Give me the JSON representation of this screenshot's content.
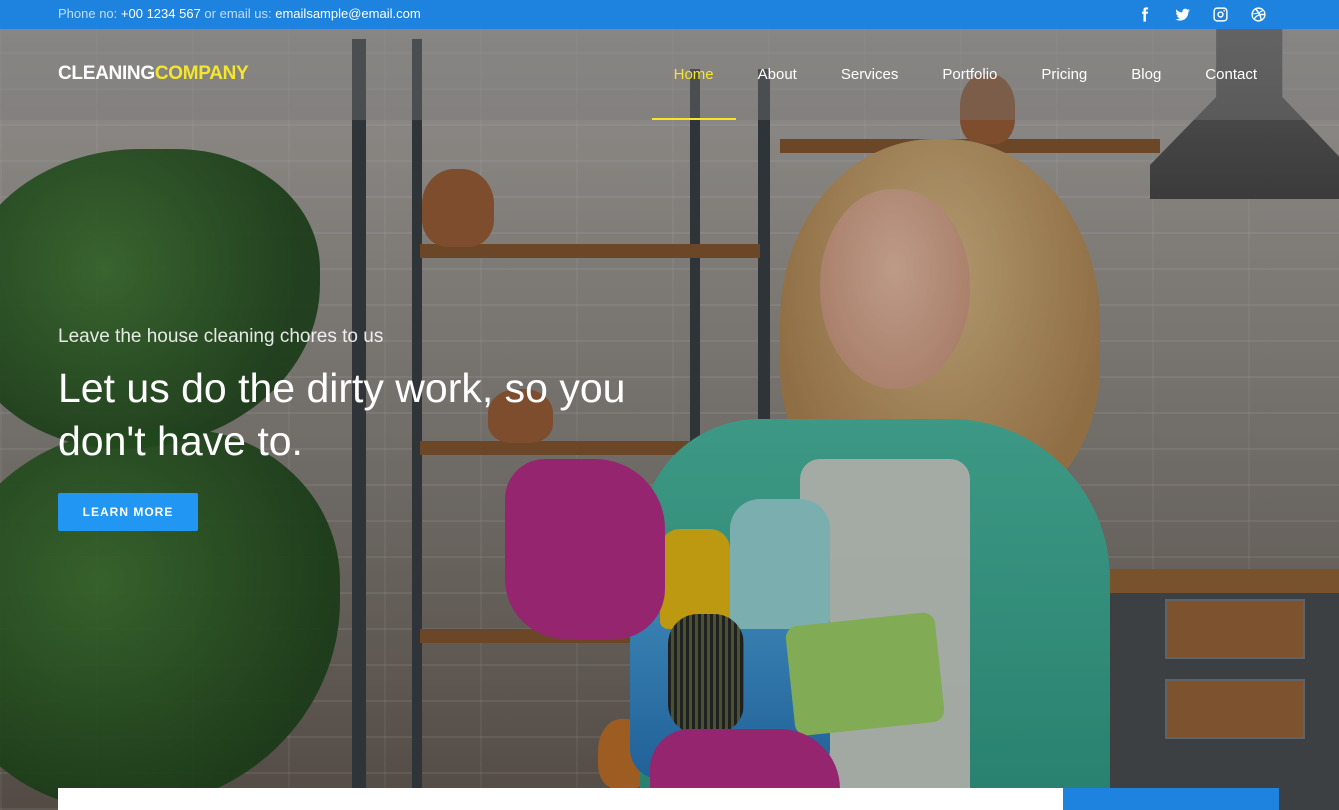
{
  "topbar": {
    "phone_label": "Phone no:",
    "phone": "+00 1234 567",
    "email_label": "or email us:",
    "email": "emailsample@email.com",
    "social_icons": [
      "facebook-icon",
      "twitter-icon",
      "instagram-icon",
      "dribbble-icon"
    ]
  },
  "brand": {
    "part1": "CLEANING",
    "part2": "COMPANY"
  },
  "nav": {
    "items": [
      "Home",
      "About",
      "Services",
      "Portfolio",
      "Pricing",
      "Blog",
      "Contact"
    ],
    "active": "Home"
  },
  "hero": {
    "kicker": "Leave the house cleaning chores to us",
    "headline": "Let us do the dirty work, so you don't have to.",
    "button": "LEARN MORE"
  },
  "colors": {
    "primary": "#1e83de",
    "button": "#2196f3",
    "accent": "#f5e62b",
    "text": "#ffffff"
  }
}
